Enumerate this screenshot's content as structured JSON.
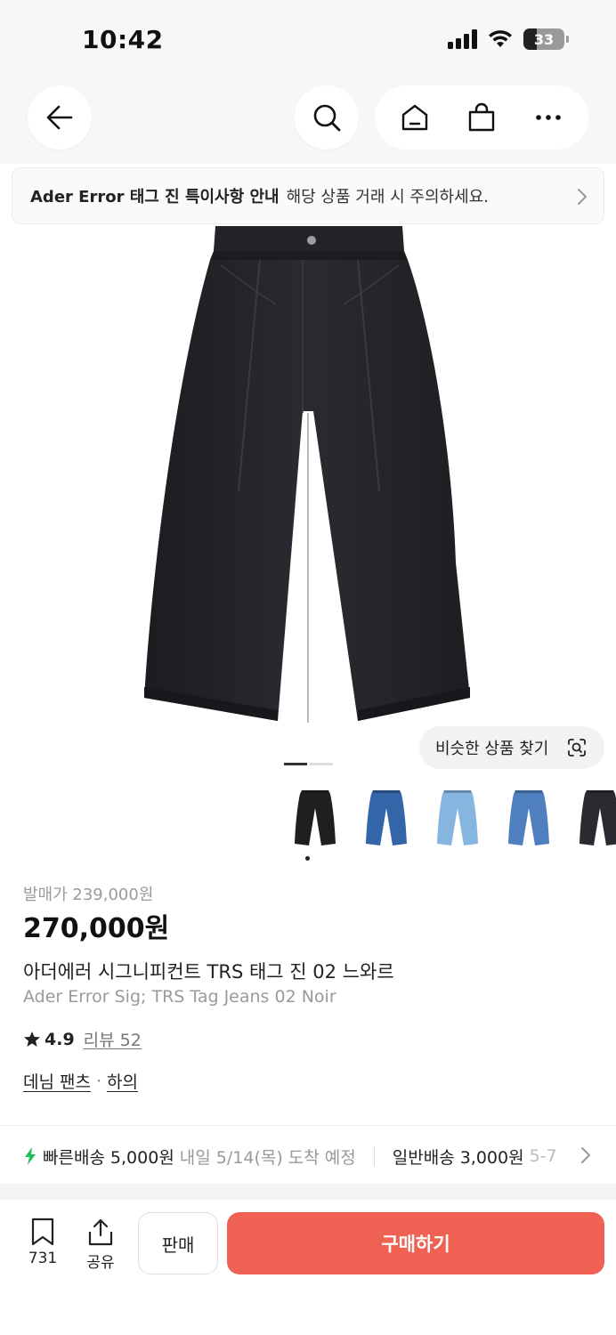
{
  "status_bar": {
    "time": "10:42",
    "battery_level": "33"
  },
  "nav": {
    "back_icon": "arrow-left-icon",
    "search_icon": "search-icon",
    "home_icon": "home-icon",
    "bag_icon": "shopping-bag-icon",
    "more_icon": "more-horizontal-icon"
  },
  "notice": {
    "title": "Ader Error 태그 진 특이사항 안내",
    "text": "해당 상품 거래 시 주의하세요."
  },
  "gallery": {
    "find_similar_label": "비슷한 상품 찾기",
    "page_count": 2,
    "current_page": 1,
    "thumbnails": [
      {
        "name": "black-wash",
        "color": "#1f1f22"
      },
      {
        "name": "mid-blue",
        "color": "#3465a8"
      },
      {
        "name": "light-blue",
        "color": "#86b6e0"
      },
      {
        "name": "medium-blue",
        "color": "#4f7fbf"
      },
      {
        "name": "black-faded",
        "color": "#2a2b30"
      }
    ]
  },
  "product": {
    "release_price": "발매가 239,000원",
    "price": "270,000원",
    "title_ko": "아더에러 시그니피컨트 TRS 태그 진 02 느와르",
    "title_en": "Ader Error Sig; TRS Tag Jeans 02 Noir",
    "rating": "4.9",
    "review_label": "리뷰 52",
    "category": "데님 팬츠",
    "category_separator": "·",
    "subcategory": "하의"
  },
  "shipping": {
    "fast_label": "빠른배송",
    "fast_price": "5,000원",
    "fast_eta": "내일 5/14(목) 도착 예정",
    "normal_label": "일반배송",
    "normal_price": "3,000원",
    "normal_eta": "5-7",
    "accent_color": "#1fbf5f"
  },
  "bottom_bar": {
    "bookmark_count": "731",
    "share_label": "공유",
    "sell_label": "판매",
    "buy_label": "구매하기",
    "buy_color": "#ef6253"
  }
}
